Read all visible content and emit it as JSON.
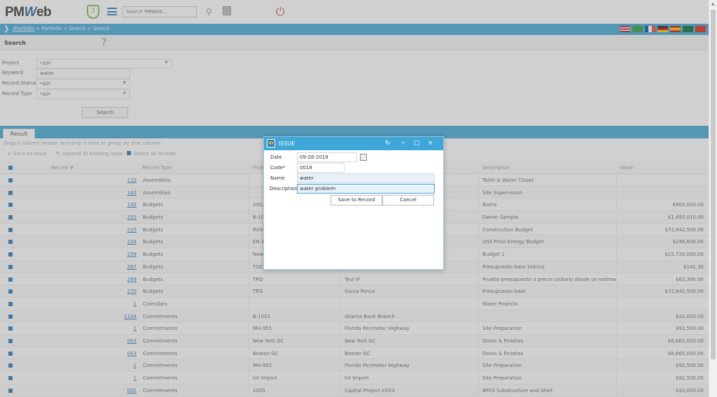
{
  "app": {
    "logo_pm": "PM",
    "logo_w": "W",
    "logo_eb": "eb",
    "shield_num": "3",
    "search_placeholder": "Search PMWeb...",
    "icons": [
      "shield-icon",
      "hamburger-icon",
      "search-icon",
      "calendar-icon",
      "power-icon"
    ]
  },
  "breadcrumb": {
    "link": "/Portfolio",
    "rest": " > Portfolio > Search > Search"
  },
  "search_panel": {
    "title": "Search",
    "help": "?",
    "button": "Search",
    "fields": [
      {
        "label": "Project",
        "value": "*All*"
      },
      {
        "label": "Keyword",
        "value": "water"
      },
      {
        "label": "Record Status",
        "value": "*All*"
      },
      {
        "label": "Record Type",
        "value": "*All*"
      }
    ]
  },
  "result": {
    "tab": "Result",
    "group_hint": "Drag a column header and drop it here to group by that column",
    "toolbar": {
      "save_as_issue": "Save As Issue",
      "append": "Append To Existing Issue",
      "select_all": "Select all records"
    },
    "columns": {
      "record": "Record #",
      "type": "Record Type",
      "project": "Proje",
      "description": "Description",
      "value": "Value"
    },
    "rows": [
      {
        "num": "110",
        "type": "Assemblies",
        "proj": "",
        "name": "",
        "desc": "Toilet & Water Closet",
        "value": ""
      },
      {
        "num": "142",
        "type": "Assemblies",
        "proj": "",
        "name": "",
        "desc": "Site Supervision",
        "value": ""
      },
      {
        "num": "150",
        "type": "Budgets",
        "proj": "2002",
        "name": "",
        "desc": "Boma",
        "value": "$900,000.00"
      },
      {
        "num": "205",
        "type": "Budgets",
        "proj": "B-10",
        "name": "",
        "desc": "Owner Sample",
        "value": "$1,450,010.00"
      },
      {
        "num": "215",
        "type": "Budgets",
        "proj": "RVSC",
        "name": "",
        "desc": "Construction Budget",
        "value": "$72,842,500.00"
      },
      {
        "num": "224",
        "type": "Budgets",
        "proj": "EN-1",
        "name": "",
        "desc": "Unit Price Energy Budget",
        "value": "$246,600.00"
      },
      {
        "num": "259",
        "type": "Budgets",
        "proj": "New",
        "name": "",
        "desc": "Budget 1",
        "value": "$15,720,000.00"
      },
      {
        "num": "267",
        "type": "Budgets",
        "proj": "TS01",
        "name": "",
        "desc": "Presupuesto base teórico",
        "value": "$141.30"
      },
      {
        "num": "269",
        "type": "Budgets",
        "proj": "TRD",
        "name": "Test IF",
        "desc": "Prueba presupuesto a precio unitario desde un estimado",
        "value": "$62,390.00"
      },
      {
        "num": "270",
        "type": "Budgets",
        "proj": "TRG",
        "name": "Garza Ponce",
        "desc": "Presupuesto base",
        "value": "$72,842,500.00"
      },
      {
        "num": "1",
        "type": "Calendars",
        "proj": "",
        "name": "",
        "desc": "Water Projects",
        "value": ""
      },
      {
        "num": "1104",
        "type": "Commitments",
        "proj": "B-1001",
        "name": "Atlanta Bank Branch",
        "desc": "",
        "value": "$42,000.00"
      },
      {
        "num": "1",
        "type": "Commitments",
        "proj": "MH-955",
        "name": "Florida Perimeter Highway",
        "desc": "Site Preparation",
        "value": "$92,500.00"
      },
      {
        "num": "003",
        "type": "Commitments",
        "proj": "New York GC",
        "name": "New York GC",
        "desc": "Doors & Finishes",
        "value": "$6,665,000.00"
      },
      {
        "num": "003",
        "type": "Commitments",
        "proj": "Boston GC",
        "name": "Boston GC",
        "desc": "Doors & Finishes",
        "value": "$6,665,000.00"
      },
      {
        "num": "1",
        "type": "Commitments",
        "proj": "MH-955",
        "name": "Florida Perimeter Highway",
        "desc": "Site Preparation",
        "value": "$92,500.00"
      },
      {
        "num": "1",
        "type": "Commitments",
        "proj": "Int Import",
        "name": "Int Import",
        "desc": "Site Preparation",
        "value": "$92,500.00"
      },
      {
        "num": "001",
        "type": "Commitments",
        "proj": "2005",
        "name": "Capital Project XXXX",
        "desc": "BP03 Substructure and Shell",
        "value": "$10,000.00"
      }
    ]
  },
  "modal": {
    "title": "ISSUE",
    "date_label": "Date",
    "date_value": "09-28-2019",
    "code_label": "Code*",
    "code_value": "0018",
    "name_label": "Name",
    "name_value": "water",
    "desc_label": "Description",
    "desc_value": "water problem",
    "save_btn": "Save to Record",
    "cancel_btn": "Cancel",
    "ctl_refresh": "↻",
    "ctl_min": "−",
    "ctl_max": "□",
    "ctl_close": "×"
  },
  "colors": {
    "accent": "#3fa6d8",
    "link": "#2a7ab8",
    "power": "#d9534f"
  }
}
